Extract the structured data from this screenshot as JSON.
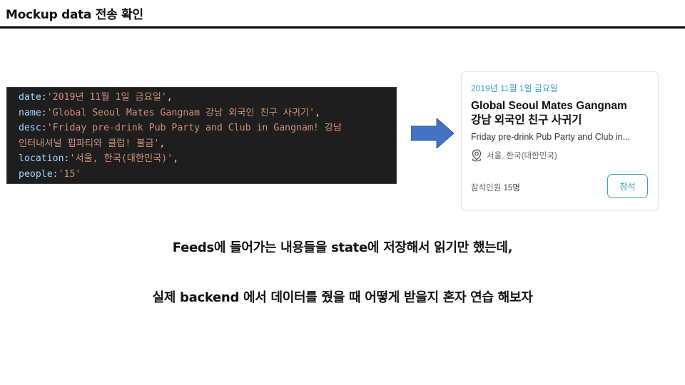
{
  "slide": {
    "title": "Mockup data 전송 확인"
  },
  "code": {
    "lines": [
      {
        "key": "date",
        "value": "'2019년 11월 1일 금요일'",
        "trail": ","
      },
      {
        "key": "name",
        "value": "'Global Seoul Mates Gangnam 강남 외국인 친구 사귀기'",
        "trail": ","
      },
      {
        "key": "desc",
        "value": "'Friday pre-drink Pub Party and Club in Gangnam! 강남",
        "trail": ""
      },
      {
        "key": "",
        "value": "인터내셔널 펍파티와 클럽! 불금'",
        "trail": ","
      },
      {
        "key": "location",
        "value": "'서울, 한국(대한민국)'",
        "trail": ","
      },
      {
        "key": "people",
        "value": "'15'",
        "trail": ""
      }
    ]
  },
  "arrow": {
    "icon": "right-arrow-icon",
    "color": "#4472c4"
  },
  "card": {
    "date": "2019년 11월 1일 금요일",
    "title_line1": "Global Seoul Mates Gangnam",
    "title_line2": "강남 외국인 친구 사귀기",
    "desc": "Friday pre-drink Pub Party and Club in...",
    "location_icon": "map-pin-icon",
    "location": "서울, 한국(대한민국)",
    "people_label": "참석인원",
    "people_count": "15명",
    "join_label": "참석",
    "accent_color": "#3aa0b8"
  },
  "captions": {
    "line1": "Feeds에 들어가는 내용들을 state에 저장해서 읽기만 했는데,",
    "line2": "실제 backend 에서 데이터를 줬을 때 어떻게 받을지 혼자 연습 해보자"
  }
}
